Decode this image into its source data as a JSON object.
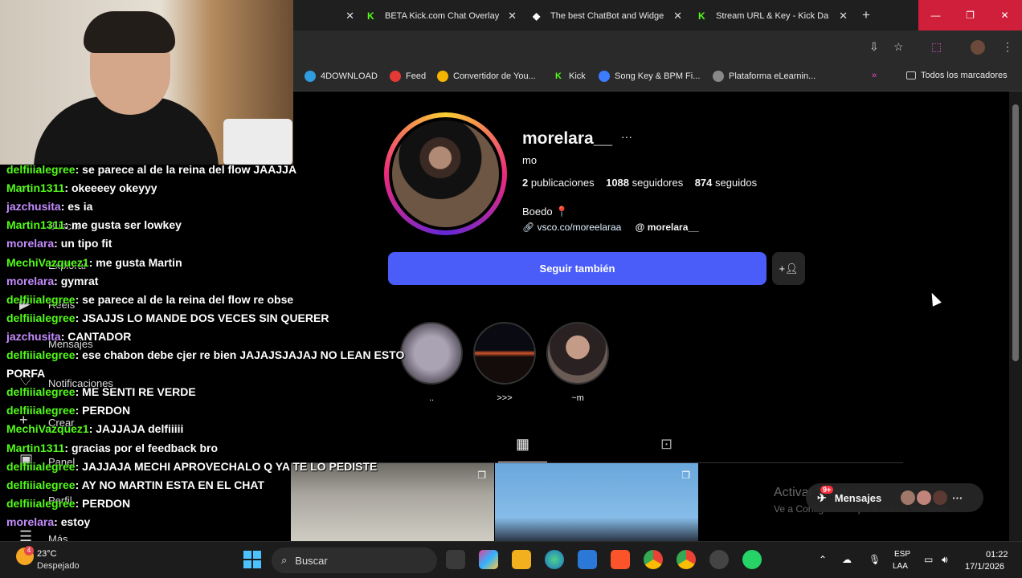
{
  "browser": {
    "tabs": [
      {
        "label": "BETA Kick.com Chat Overlay",
        "icon": "kick-icon"
      },
      {
        "label": "The best ChatBot and Widge",
        "icon": "streamelements-icon"
      },
      {
        "label": "Stream URL & Key - Kick Da",
        "icon": "kick-icon"
      }
    ],
    "window_controls": [
      "—",
      "❐",
      "✕"
    ],
    "bookmarks": [
      {
        "label": "4DOWNLOAD",
        "icon": "4download-icon",
        "color": "#2f9de0"
      },
      {
        "label": "Feed",
        "icon": "feed-icon",
        "color": "#e53935"
      },
      {
        "label": "Convertidor de You...",
        "icon": "converter-icon",
        "color": "#f4b400"
      },
      {
        "label": "Kick",
        "icon": "kick-icon",
        "color": "#53fc18"
      },
      {
        "label": "Song Key & BPM Fi...",
        "icon": "music-icon",
        "color": "#3d7bff"
      },
      {
        "label": "Plataforma eLearnin...",
        "icon": "elearning-icon",
        "color": "#888888"
      }
    ],
    "all_bookmarks": "Todos los marcadores"
  },
  "profile": {
    "username": "morelara__",
    "full_name": "mo",
    "posts_count": "2",
    "posts_label": "publicaciones",
    "followers_count": "1088",
    "followers_label": "seguidores",
    "following_count": "874",
    "following_label": "seguidos",
    "location": "Boedo 📍",
    "link": "vsco.co/moreelaraa",
    "threads_handle": "morelara__",
    "follow_button": "Seguir también"
  },
  "highlights": [
    {
      "label": ".."
    },
    {
      "label": ">>>"
    },
    {
      "label": "~m"
    }
  ],
  "windows_activation": {
    "line1": "Activar Windows",
    "line2": "Ve a Configuración para activar Windows."
  },
  "messages": {
    "label": "Mensajes",
    "badge": "9+"
  },
  "chat": [
    {
      "user": "delfiiialegree",
      "color": "#53fc18",
      "msg": "se parece al de la reina del flow JAAJJA"
    },
    {
      "user": "Martin1311",
      "color": "#53fc18",
      "msg": "okeeeey okeyyy"
    },
    {
      "user": "jazchusita",
      "color": "#c58cff",
      "msg": "es ia"
    },
    {
      "user": "Martin1311",
      "color": "#53fc18",
      "msg": "me gusta ser lowkey"
    },
    {
      "user": "morelara",
      "color": "#c58cff",
      "msg": "un tipo fit"
    },
    {
      "user": "MechiVazquez1",
      "color": "#53fc18",
      "msg": "me gusta Martin"
    },
    {
      "user": "morelara",
      "color": "#c58cff",
      "msg": "gymrat"
    },
    {
      "user": "delfiiialegree",
      "color": "#53fc18",
      "msg": "se parece al de la reina del flow re obse"
    },
    {
      "user": "delfiiialegree",
      "color": "#53fc18",
      "msg": "JSAJJS LO MANDE DOS VECES SIN QUERER"
    },
    {
      "user": "jazchusita",
      "color": "#c58cff",
      "msg": "CANTADOR"
    },
    {
      "user": "delfiiialegree",
      "color": "#53fc18",
      "msg": "ese chabon debe cjer re bien JAJAJSJAJAJ NO LEAN ESTO"
    },
    {
      "user": "",
      "color": "#ffffff",
      "msg": "PORFA"
    },
    {
      "user": "delfiiialegree",
      "color": "#53fc18",
      "msg": "ME SENTI RE VERDE"
    },
    {
      "user": "delfiiialegree",
      "color": "#53fc18",
      "msg": "PERDON"
    },
    {
      "user": "MechiVazquez1",
      "color": "#53fc18",
      "msg": "JAJJAJA delfiiiii"
    },
    {
      "user": "Martin1311",
      "color": "#53fc18",
      "msg": "gracias por el feedback bro"
    },
    {
      "user": "delfiiialegree",
      "color": "#53fc18",
      "msg": "JAJJAJA MECHI APROVECHALO Q YA TE LO PEDISTE"
    },
    {
      "user": "delfiiialegree",
      "color": "#53fc18",
      "msg": "AY NO MARTIN ESTA EN EL CHAT"
    },
    {
      "user": "delfiiialegree",
      "color": "#53fc18",
      "msg": "PERDON"
    },
    {
      "user": "morelara",
      "color": "#c58cff",
      "msg": "estoy"
    }
  ],
  "ig_nav": [
    {
      "label": "Buscar",
      "icon": "search-icon"
    },
    {
      "label": "Explorar",
      "icon": "compass-icon"
    },
    {
      "label": "Reels",
      "icon": "reels-icon"
    },
    {
      "label": "Mensajes",
      "icon": "messenger-icon"
    },
    {
      "label": "Notificaciones",
      "icon": "heart-icon"
    },
    {
      "label": "Crear",
      "icon": "plus-icon"
    },
    {
      "label": "Panel",
      "icon": "dashboard-icon"
    },
    {
      "label": "Perfil",
      "icon": "profile-icon"
    },
    {
      "label": "Más",
      "icon": "menu-icon"
    }
  ],
  "taskbar": {
    "temperature": "23°C",
    "weather": "Despejado",
    "weather_badge": "4",
    "search_placeholder": "Buscar",
    "lang1": "ESP",
    "lang2": "LAA",
    "time": "01:22",
    "date": "17/1/2026"
  }
}
